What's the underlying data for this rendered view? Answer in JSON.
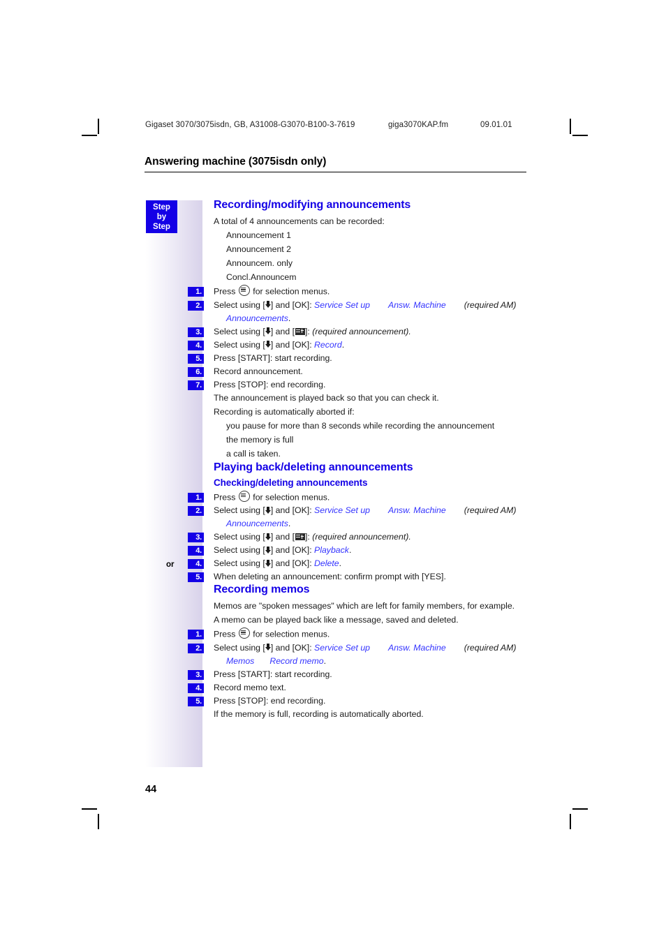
{
  "header": {
    "doc_id": "Gigaset 3070/3075isdn, GB, A31008-G3070-B100-3-7619",
    "file_name": "giga3070KAP.fm",
    "date": "09.01.01"
  },
  "chapter_title": "Answering machine (3075isdn only)",
  "sidebar": {
    "step_by_step_line1": "Step",
    "step_by_step_line2": "by",
    "step_by_step_line3": "Step",
    "or_label": "or"
  },
  "page_number": "44",
  "colors": {
    "accent_blue": "#1400e6",
    "menu_path_blue": "#3333ff",
    "sidebar_gradient_end": "#d8d2ea"
  },
  "sections": [
    {
      "id": "recording-modifying-announcements",
      "heading": "Recording/modifying announcements",
      "intro": "A total of 4 announcements can be recorded:",
      "list": [
        "Announcement 1",
        "Announcement 2",
        "Announcem. only",
        "Concl.Announcem"
      ],
      "steps": [
        {
          "num": "1.",
          "prefix": "Press ",
          "suffix": " for selection menus."
        },
        {
          "num": "2.",
          "prefix": "Select using [",
          "mid": "] and [OK]: ",
          "path1": "Service Set up",
          "path2": "Answ. Machine",
          "note": "(required AM)",
          "path3": "Announcements",
          "tail": "."
        },
        {
          "num": "3.",
          "prefix": "Select using [",
          "mid": "] and [",
          "mid2": "]: ",
          "note": "(required announcement)",
          "tail": "."
        },
        {
          "num": "4.",
          "prefix": "Select using [",
          "mid": "] and [OK]: ",
          "path1": "Record",
          "tail": "."
        },
        {
          "num": "5.",
          "text": "Press [START]: start recording."
        },
        {
          "num": "6.",
          "text": "Record announcement."
        },
        {
          "num": "7.",
          "text": "Press [STOP]: end recording."
        }
      ],
      "after_steps": [
        "The announcement is played back so that you can check it.",
        "Recording is automatically aborted if:"
      ],
      "after_list": [
        "you pause for more than 8 seconds while recording the announcement",
        "the memory is full",
        "a call is taken."
      ]
    },
    {
      "id": "playing-back-deleting-announcements",
      "heading": "Playing back/deleting announcements",
      "subheading": "Checking/deleting announcements",
      "steps": [
        {
          "num": "1.",
          "prefix": "Press ",
          "suffix": " for selection menus."
        },
        {
          "num": "2.",
          "prefix": "Select using [",
          "mid": "] and [OK]: ",
          "path1": "Service Set up",
          "path2": "Answ. Machine",
          "note": "(required AM)",
          "path3": "Announcements",
          "tail": "."
        },
        {
          "num": "3.",
          "prefix": "Select using [",
          "mid": "] and [",
          "mid2": "]: ",
          "note": "(required announcement)",
          "tail": "."
        },
        {
          "num": "4.",
          "prefix": "Select using [",
          "mid": "] and [OK]: ",
          "path1": "Playback",
          "tail": "."
        },
        {
          "num": "4.",
          "or": "or",
          "prefix": "Select using [",
          "mid": "] and [OK]: ",
          "path1": "Delete",
          "tail": "."
        },
        {
          "num": "5.",
          "text": "When deleting an announcement: confirm prompt with [YES]."
        }
      ]
    },
    {
      "id": "recording-memos",
      "heading": "Recording memos",
      "intro_lines": [
        "Memos are \"spoken messages\" which are left for family members, for example.",
        "A memo can be played back like a message, saved and deleted."
      ],
      "steps": [
        {
          "num": "1.",
          "prefix": "Press ",
          "suffix": " for selection menus."
        },
        {
          "num": "2.",
          "prefix": "Select using [",
          "mid": "] and [OK]: ",
          "path1": "Service Set up",
          "path2": "Answ. Machine",
          "note": "(required AM)",
          "path3": "Memos",
          "path4": "Record memo",
          "tail": "."
        },
        {
          "num": "3.",
          "text": "Press [START]: start recording."
        },
        {
          "num": "4.",
          "text": "Record memo text."
        },
        {
          "num": "5.",
          "text": "Press [STOP]: end recording."
        }
      ],
      "closing": "If the memory is full, recording is automatically aborted."
    }
  ],
  "icons": {
    "menu_key": "menu-key-icon",
    "display_key": "display-key-icon",
    "down_arrow": "down-arrow-icon"
  }
}
